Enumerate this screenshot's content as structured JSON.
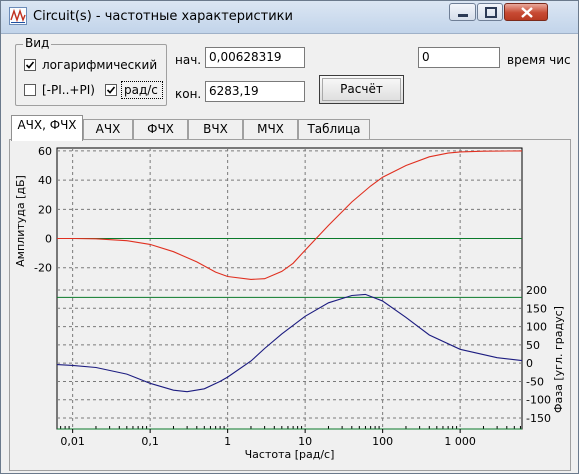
{
  "window": {
    "title": "Circuit(s) - частотные характеристики"
  },
  "view_group": {
    "title": "Вид",
    "log_checkbox": {
      "label": "логарифмический",
      "checked": true
    },
    "pi_checkbox": {
      "label": "[-PI..+PI)",
      "checked": false
    },
    "rad_checkbox": {
      "label": "рад/с",
      "checked": true
    }
  },
  "range": {
    "start_label": "нач.",
    "start_value": "0,00628319",
    "end_label": "кон.",
    "end_value": "6283,19"
  },
  "time": {
    "value": "0",
    "label": "время чис"
  },
  "calculate_button": "Расчёт",
  "tabs": [
    "АЧХ, ФЧХ",
    "АЧХ",
    "ФЧХ",
    "ВЧХ",
    "МЧХ",
    "Таблица"
  ],
  "active_tab": 0,
  "chart_data": [
    {
      "type": "line",
      "ylabel": "Амплитуда [дБ]",
      "xscale": "log",
      "xlim": [
        0.00628319,
        6283.19
      ],
      "ylim": [
        -38,
        62
      ],
      "yticks": [
        -20,
        0,
        20,
        40,
        60
      ],
      "ytick_labels": [
        "-20",
        "0",
        "20",
        "40",
        "60"
      ],
      "reference_lines": [
        0
      ],
      "series": [
        {
          "color": "#e03020",
          "x": [
            0.00628,
            0.01,
            0.02,
            0.05,
            0.1,
            0.2,
            0.4,
            0.7,
            1,
            2,
            3,
            5,
            7,
            10,
            20,
            40,
            70,
            100,
            200,
            400,
            700,
            1000,
            2000,
            6283
          ],
          "y": [
            0,
            0,
            -0.2,
            -1.5,
            -4,
            -9,
            -16,
            -23,
            -26,
            -28,
            -27.5,
            -22.5,
            -17,
            -8,
            9,
            25,
            36,
            42,
            50,
            56,
            58.5,
            59.3,
            59.8,
            60
          ]
        }
      ]
    },
    {
      "type": "line",
      "xlabel": "Частота [рад/с]",
      "ylabel": "Фаза [угл. градус]",
      "xscale": "log",
      "xlim": [
        0.00628319,
        6283.19
      ],
      "ylim": [
        -180,
        200
      ],
      "yticks": [
        -150,
        -100,
        -50,
        0,
        50,
        100,
        150,
        200
      ],
      "ytick_labels": [
        "-150",
        "-100",
        "-50",
        "0",
        "50",
        "100",
        "150",
        "200"
      ],
      "xticks": [
        0.01,
        0.1,
        1,
        10,
        100,
        1000
      ],
      "xtick_labels": [
        "0,01",
        "0,1",
        "1",
        "10",
        "100",
        "1 000"
      ],
      "reference_lines": [
        -180,
        180
      ],
      "series": [
        {
          "color": "#1c1c80",
          "x": [
            0.00628,
            0.01,
            0.02,
            0.05,
            0.1,
            0.2,
            0.3,
            0.5,
            0.8,
            1,
            2,
            3,
            5,
            10,
            20,
            40,
            60,
            100,
            200,
            400,
            1000,
            3000,
            6283
          ],
          "y": [
            -4,
            -6,
            -12,
            -30,
            -55,
            -74,
            -78,
            -70,
            -50,
            -38,
            6,
            40,
            80,
            128,
            165,
            185,
            188,
            170,
            125,
            77,
            38,
            15,
            7
          ]
        }
      ]
    }
  ]
}
